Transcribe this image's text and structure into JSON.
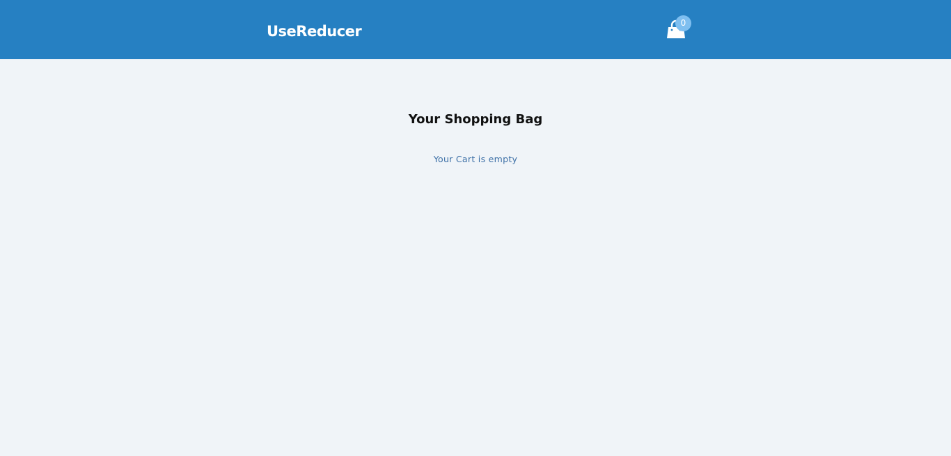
{
  "navbar": {
    "brand": "UseReducer",
    "cart_icon": "shopping-bag-icon",
    "cart_count": "0",
    "background": "#2680c2",
    "badge_color": "#7fbff0"
  },
  "main": {
    "title": "Your Shopping Bag",
    "empty_message": "Your Cart is empty",
    "background": "#f0f4f8",
    "message_color": "#3c6fa6"
  }
}
